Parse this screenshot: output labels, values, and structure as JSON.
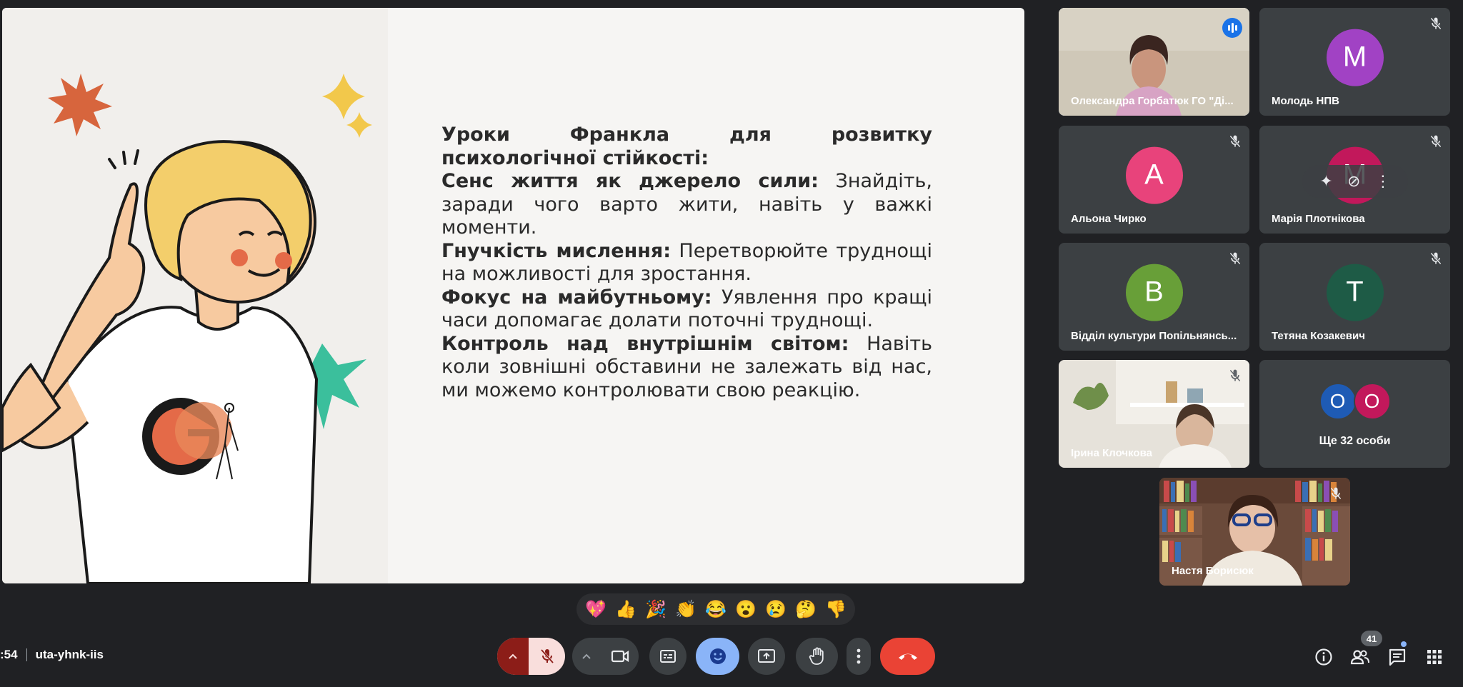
{
  "meeting": {
    "time_partial": ":54",
    "code": "uta-yhnk-iis"
  },
  "slide": {
    "title": "Уроки Франкла для розвитку психологічної стійкості:",
    "points": [
      {
        "heading": "Сенс життя як джерело сили:",
        "text": " Знайдіть, заради чого варто жити, навіть у важкі моменти."
      },
      {
        "heading": "Гнучкість мислення:",
        "text": " Перетворюйте труднощі на можливості для зростання."
      },
      {
        "heading": "Фокус на майбутньому:",
        "text": " Уявлення про кращі часи допомагає долати поточні труднощі."
      },
      {
        "heading": "Контроль над внутрішнім світом:",
        "text": " Навіть коли зовнішні обставини не залежать від нас, ми можемо контролювати свою реакцію."
      }
    ]
  },
  "participants": [
    {
      "name": "Олександра Горбатюк ГО \"Ді...",
      "type": "video",
      "speaking": true
    },
    {
      "name": "Молодь НПВ",
      "initial": "M",
      "color": "#a142c4"
    },
    {
      "name": "Альона Чирко",
      "initial": "А",
      "color": "#e8437b"
    },
    {
      "name": "Марія Плотнікова",
      "initial": "M",
      "color": "#c2185b"
    },
    {
      "name": "Відділ культури Попільнянсь...",
      "initial": "В",
      "color": "#689f38"
    },
    {
      "name": "Тетяна Козакевич",
      "initial": "Т",
      "color": "#1e5b46"
    },
    {
      "name": "Ірина Клочкова",
      "type": "video"
    },
    {
      "name": "Ще 32 особи",
      "mini": [
        "О",
        "О"
      ],
      "mini_colors": [
        "#1e5bb5",
        "#c2185b"
      ]
    },
    {
      "name": "Настя Борисюк",
      "type": "video"
    }
  ],
  "reactions": [
    "💖",
    "👍",
    "🎉",
    "👏",
    "😂",
    "😮",
    "😢",
    "🤔",
    "👎"
  ],
  "people_count": "41",
  "colors": {
    "background": "#202124",
    "tile": "#3c4043",
    "end_call": "#ea4335",
    "mic_off": "#f9dedc",
    "active_emoji": "#8ab4f8"
  }
}
